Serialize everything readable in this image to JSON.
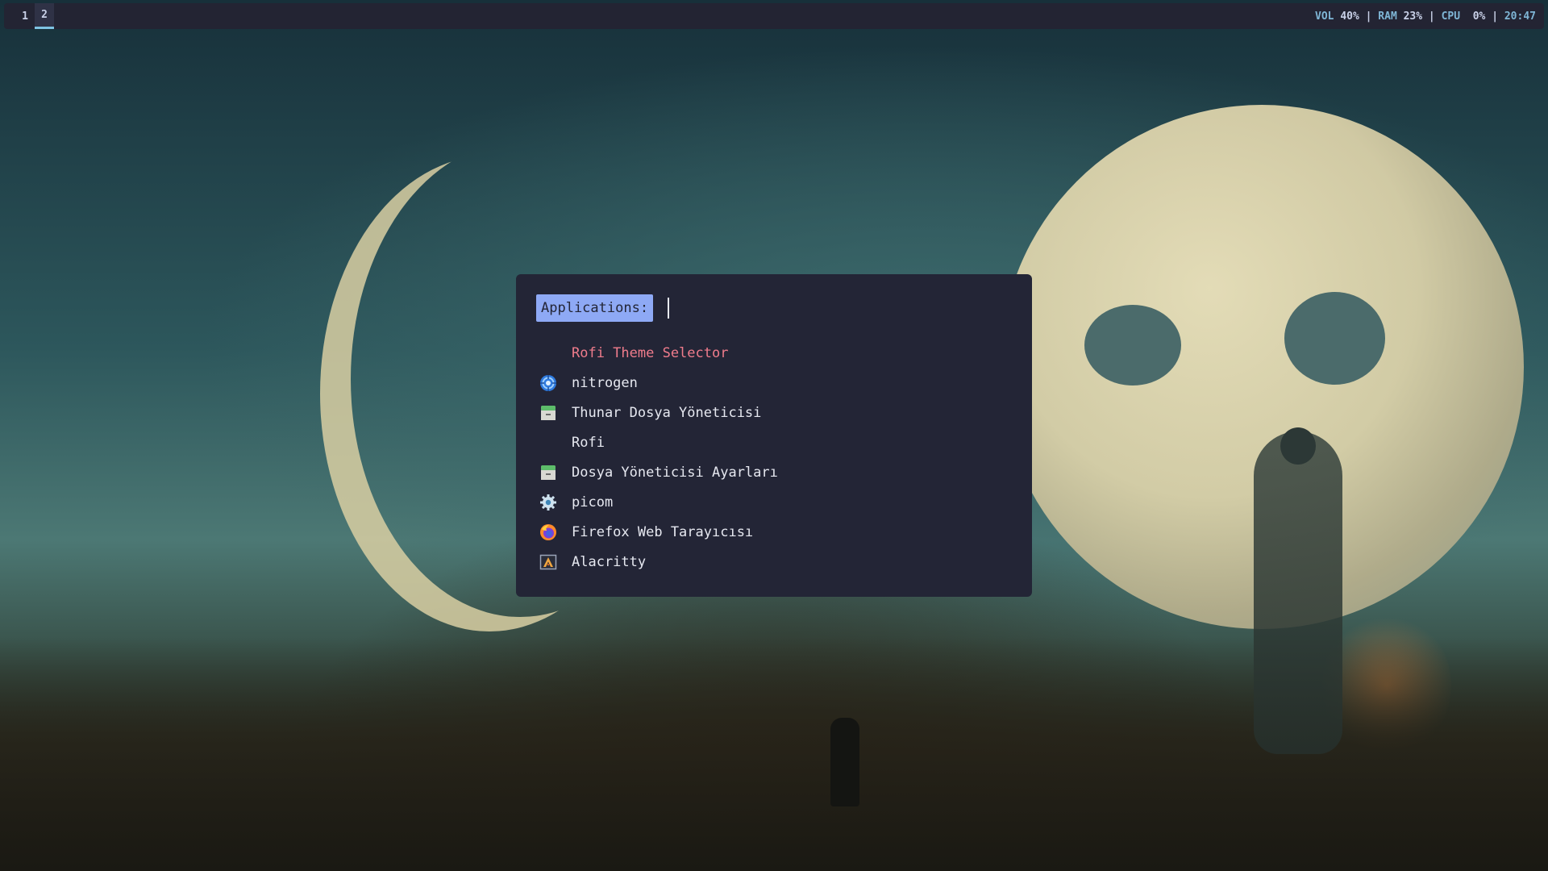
{
  "topbar": {
    "workspaces": [
      "1",
      "2"
    ],
    "active_workspace": "2",
    "status": {
      "vol_label": "VOL",
      "vol_value": "40%",
      "ram_label": "RAM",
      "ram_value": "23%",
      "cpu_label": "CPU",
      "cpu_value": "0%",
      "separator": "|",
      "clock": "20:47"
    }
  },
  "rofi": {
    "prompt": "Applications:",
    "entry_value": "",
    "items": [
      {
        "label": "Rofi Theme Selector",
        "icon": "none",
        "selected": true
      },
      {
        "label": "nitrogen",
        "icon": "nitrogen-icon"
      },
      {
        "label": "Thunar Dosya Yöneticisi",
        "icon": "file-manager-icon"
      },
      {
        "label": "Rofi",
        "icon": "none"
      },
      {
        "label": "Dosya Yöneticisi Ayarları",
        "icon": "file-manager-settings-icon"
      },
      {
        "label": "picom",
        "icon": "gear-icon"
      },
      {
        "label": "Firefox Web Tarayıcısı",
        "icon": "firefox-icon"
      },
      {
        "label": "Alacritty",
        "icon": "alacritty-icon"
      }
    ]
  },
  "colors": {
    "bar_bg": "#232433",
    "rofi_bg": "#232536",
    "prompt_bg": "#8ea9f5",
    "selected_text": "#ef7c8c",
    "accent": "#7fb6d6"
  }
}
